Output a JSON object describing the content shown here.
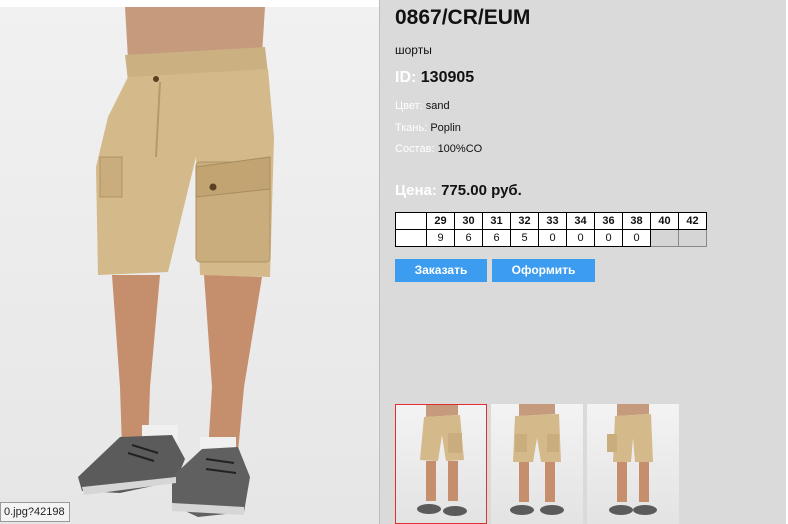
{
  "product": {
    "article": "0867/CR/EUM",
    "type": "шорты",
    "id_label": "ID:",
    "id_value": "130905",
    "color_label": "Цвет:",
    "color_value": "sand",
    "fabric_label": "Ткань:",
    "fabric_value": "Poplin",
    "composition_label": "Состав:",
    "composition_value": "100%CO",
    "price_label": "Цена:",
    "price_value": "775.00 руб."
  },
  "sizes": {
    "headers": [
      "29",
      "30",
      "31",
      "32",
      "33",
      "34",
      "36",
      "38",
      "40",
      "42"
    ],
    "stock": [
      "9",
      "6",
      "6",
      "5",
      "0",
      "0",
      "0",
      "0",
      "",
      ""
    ]
  },
  "buttons": {
    "order": "Заказать",
    "checkout": "Оформить"
  },
  "status_tip": "0.jpg?42198",
  "colors": {
    "accent_button": "#3b9cf0",
    "panel_bg": "#dadada",
    "label_text": "#ffffff",
    "selected_thumb_border": "#e03030",
    "product_color": "#c9ad7c"
  }
}
